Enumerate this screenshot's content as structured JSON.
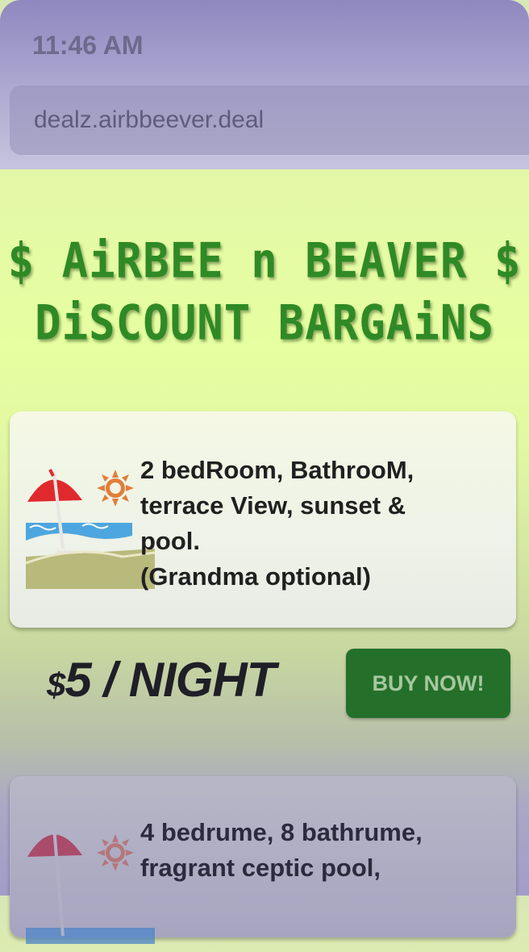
{
  "status": {
    "time": "11:46 AM"
  },
  "browser": {
    "url": "dealz.airbbeever.deal"
  },
  "banner": {
    "line1": "$ AiRBEE n BEAVER $",
    "line2": "DiSCOUNT BARGAiNS",
    "color": "#2f8a25"
  },
  "listings": [
    {
      "icons": [
        "beach-umbrella-icon",
        "sun-icon"
      ],
      "description_lines": [
        "2 bedRoom, BathrooM,",
        "terrace View, sunset &",
        "pool.",
        "(Grandma optional)"
      ],
      "price": {
        "currency": "$",
        "amount": "5 / NIGHT"
      },
      "buy_label": "BUY NOW!"
    },
    {
      "icons": [
        "beach-umbrella-icon",
        "sun-icon"
      ],
      "description_lines": [
        "4 bedrume, 8 bathrume,",
        "fragrant ceptic pool,"
      ]
    }
  ],
  "colors": {
    "buy_button": "#24702a",
    "card_bg": "#f4f8e4"
  }
}
